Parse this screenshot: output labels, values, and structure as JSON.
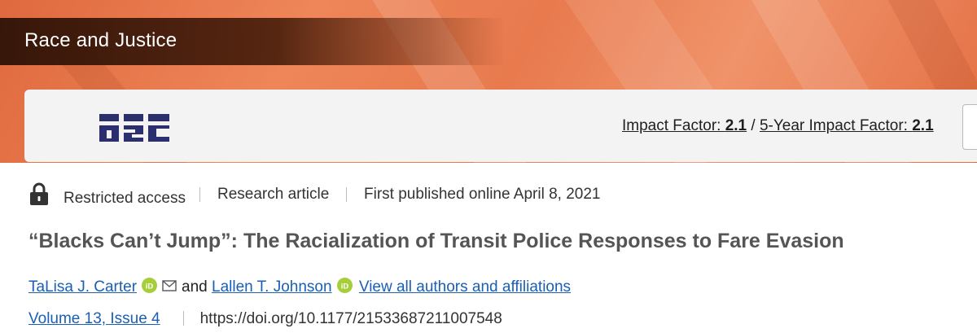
{
  "journal": {
    "name": "Race and Justice"
  },
  "metrics": {
    "impact_label": "Impact Factor:",
    "impact_value": "2.1",
    "divider": "/",
    "five_year_label": "5-Year Impact Factor:",
    "five_year_value": "2.1"
  },
  "article": {
    "access": "Restricted access",
    "type": "Research article",
    "published": "First published online April 8, 2021",
    "title": "“Blacks Can’t Jump”: The Racialization of Transit Police Responses to Fare Evasion",
    "authors": [
      {
        "name": "TaLisa J. Carter"
      },
      {
        "name": "Lallen T. Johnson"
      }
    ],
    "author_joiner": "and",
    "view_all": "View all authors and affiliations",
    "volume_issue": "Volume 13, Issue 4",
    "doi": "https://doi.org/10.1177/21533687211007548"
  },
  "colors": {
    "banner": "#e87a4e",
    "link": "#1a5fb4",
    "logo": "#2c2f6e",
    "orcid": "#a6ce39"
  },
  "icons": {
    "lock": "lock-icon",
    "orcid": "orcid-icon",
    "mail": "mail-icon",
    "logo": "journal-logo"
  }
}
